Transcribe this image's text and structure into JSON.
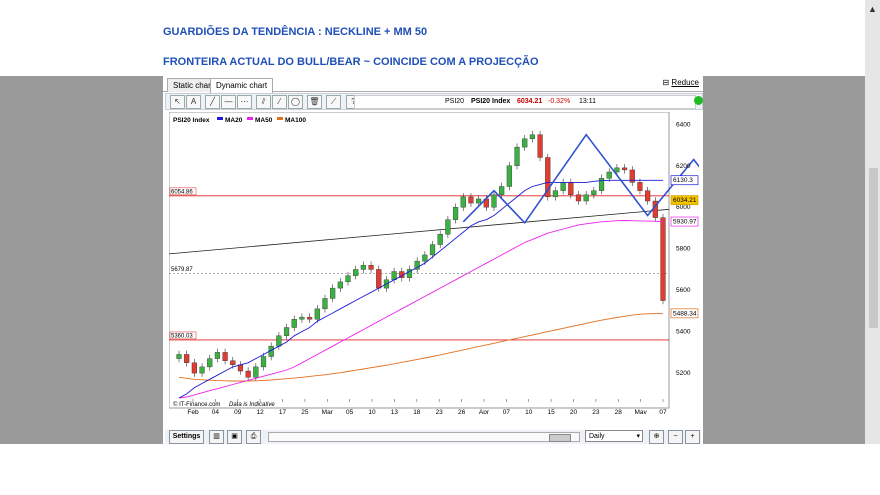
{
  "headings": {
    "line1": "GUARDIÕES DA TENDÊNCIA : NECKLINE + MM 50",
    "line2": "FRONTEIRA ACTUAL DO BULL/BEAR ~ COINCIDE COM A PROJECÇÃO"
  },
  "tabs": {
    "static": "Static chart",
    "dynamic": "Dynamic chart",
    "reduce": "Reduce"
  },
  "ticker": {
    "name": "PSI20",
    "index": "PSI20 Index",
    "price": "6034.21",
    "change": "-0.32%",
    "time": "13:11"
  },
  "buttons": {
    "settings": "Settings"
  },
  "period": "Daily",
  "colors": {
    "up": "#3cb043",
    "down": "#e03c31",
    "ma20": "#1b1bd8",
    "ma50": "#ee22ee",
    "ma100": "#e07020",
    "hline": "#e02020",
    "pattern": "#3050d0"
  },
  "chart_data": {
    "type": "candlestick",
    "legend": [
      "PSI20 Index",
      "MA20",
      "MA50",
      "MA100"
    ],
    "legend_placement": "top-left",
    "ylim": [
      5080,
      6440
    ],
    "y_ticks": [
      5200,
      5400,
      5600,
      5800,
      6000,
      6200,
      6400
    ],
    "x_tick_labels": [
      "Feb",
      "04",
      "09",
      "12",
      "17",
      "25",
      "Mar",
      "05",
      "10",
      "13",
      "18",
      "23",
      "26",
      "Apr",
      "07",
      "10",
      "15",
      "20",
      "23",
      "28",
      "May",
      "07"
    ],
    "price_labels": {
      "line_a": "6054.86",
      "line_b": "5679.87",
      "line_c": "5360.03",
      "ma20": "6130.3",
      "last": "6034.21",
      "ma50": "5930.97",
      "ma100": "5488.34"
    },
    "footer": {
      "source": "© IT-Finance.com",
      "note": "Data is Indicative"
    },
    "closes": [
      5290,
      5250,
      5200,
      5230,
      5270,
      5300,
      5260,
      5240,
      5210,
      5180,
      5230,
      5280,
      5330,
      5380,
      5420,
      5460,
      5470,
      5460,
      5510,
      5560,
      5610,
      5640,
      5670,
      5700,
      5720,
      5700,
      5610,
      5650,
      5690,
      5660,
      5700,
      5740,
      5770,
      5820,
      5870,
      5940,
      6000,
      6050,
      6020,
      6040,
      6000,
      6060,
      6100,
      6200,
      6290,
      6330,
      6350,
      6240,
      6050,
      6080,
      6120,
      6060,
      6030,
      6060,
      6080,
      6140,
      6170,
      6190,
      6180,
      6120,
      6080,
      6030,
      5950,
      5550
    ],
    "ma20": [
      5080,
      5100,
      5130,
      5150,
      5170,
      5190,
      5210,
      5230,
      5240,
      5250,
      5270,
      5290,
      5310,
      5330,
      5350,
      5380,
      5400,
      5420,
      5450,
      5470,
      5490,
      5510,
      5530,
      5550,
      5570,
      5590,
      5610,
      5630,
      5650,
      5670,
      5690,
      5710,
      5730,
      5760,
      5790,
      5820,
      5850,
      5880,
      5910,
      5930,
      5940,
      5960,
      5990,
      6020,
      6050,
      6080,
      6100,
      6110,
      6120,
      6120,
      6120,
      6120,
      6120,
      6120,
      6125,
      6128,
      6130,
      6130,
      6130,
      6130,
      6130,
      6130,
      6130,
      6130
    ],
    "ma50": [
      5080,
      5085,
      5095,
      5105,
      5115,
      5125,
      5135,
      5145,
      5155,
      5165,
      5175,
      5185,
      5195,
      5205,
      5215,
      5230,
      5250,
      5270,
      5290,
      5310,
      5330,
      5350,
      5370,
      5390,
      5410,
      5430,
      5450,
      5470,
      5490,
      5510,
      5530,
      5550,
      5570,
      5590,
      5610,
      5630,
      5650,
      5670,
      5690,
      5710,
      5730,
      5750,
      5770,
      5790,
      5810,
      5830,
      5845,
      5860,
      5875,
      5885,
      5895,
      5905,
      5915,
      5920,
      5925,
      5930,
      5932,
      5935,
      5936,
      5935,
      5934,
      5933,
      5932,
      5931
    ],
    "ma100": [
      5180,
      5175,
      5170,
      5168,
      5166,
      5164,
      5163,
      5162,
      5162,
      5162,
      5163,
      5165,
      5167,
      5170,
      5173,
      5176,
      5180,
      5184,
      5188,
      5192,
      5197,
      5202,
      5208,
      5214,
      5220,
      5226,
      5232,
      5238,
      5245,
      5252,
      5259,
      5266,
      5273,
      5280,
      5288,
      5296,
      5304,
      5312,
      5320,
      5328,
      5336,
      5344,
      5352,
      5360,
      5368,
      5376,
      5384,
      5392,
      5400,
      5408,
      5416,
      5424,
      5432,
      5440,
      5448,
      5455,
      5462,
      5468,
      5474,
      5480,
      5484,
      5486,
      5488,
      5488
    ]
  }
}
